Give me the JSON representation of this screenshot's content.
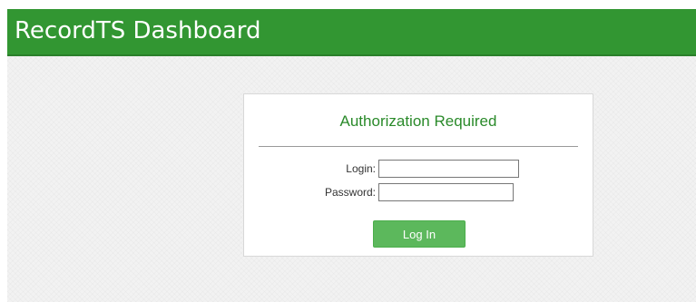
{
  "header": {
    "title": "RecordTS Dashboard"
  },
  "auth": {
    "title": "Authorization Required",
    "login_label": "Login:",
    "login_value": "",
    "password_label": "Password:",
    "password_value": "",
    "submit_label": "Log In"
  },
  "colors": {
    "header_background": "#329632",
    "title_accent": "#2a8a2a",
    "button_background": "#5cb85c"
  }
}
